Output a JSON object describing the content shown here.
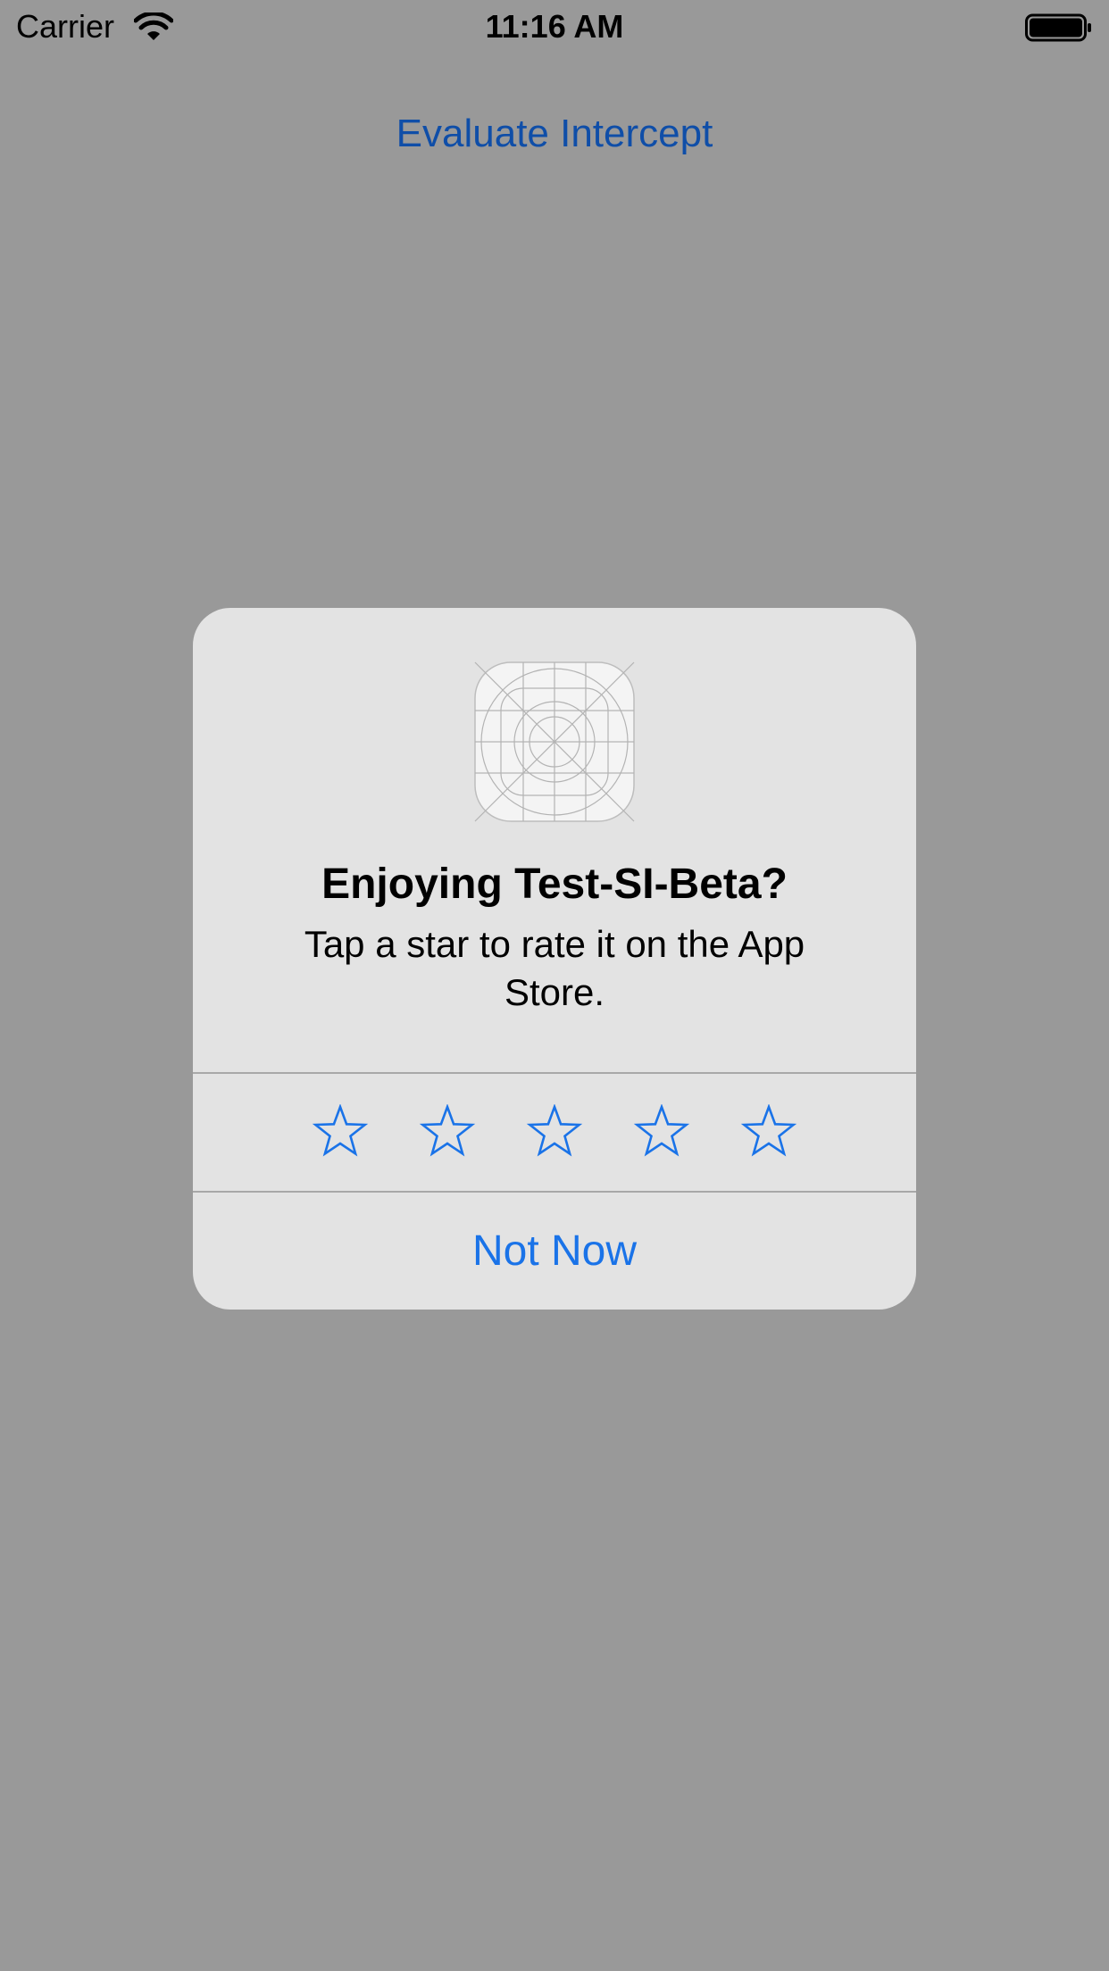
{
  "status_bar": {
    "carrier": "Carrier",
    "time": "11:16 AM",
    "wifi_icon": "wifi-icon",
    "battery_icon": "battery-icon"
  },
  "main": {
    "link_label": "Evaluate Intercept"
  },
  "rating_dialog": {
    "app_icon": "app-icon-placeholder",
    "title": "Enjoying Test-SI-Beta?",
    "message": "Tap a star to rate it on the App Store.",
    "rating": {
      "selected": 0,
      "max": 5
    },
    "stars": [
      "star-1",
      "star-2",
      "star-3",
      "star-4",
      "star-5"
    ],
    "dismiss_label": "Not Now"
  },
  "colors": {
    "background": "#999999",
    "dialog_background": "#e3e3e3",
    "accent": "#1a73e8",
    "link": "#0f4ea8"
  }
}
